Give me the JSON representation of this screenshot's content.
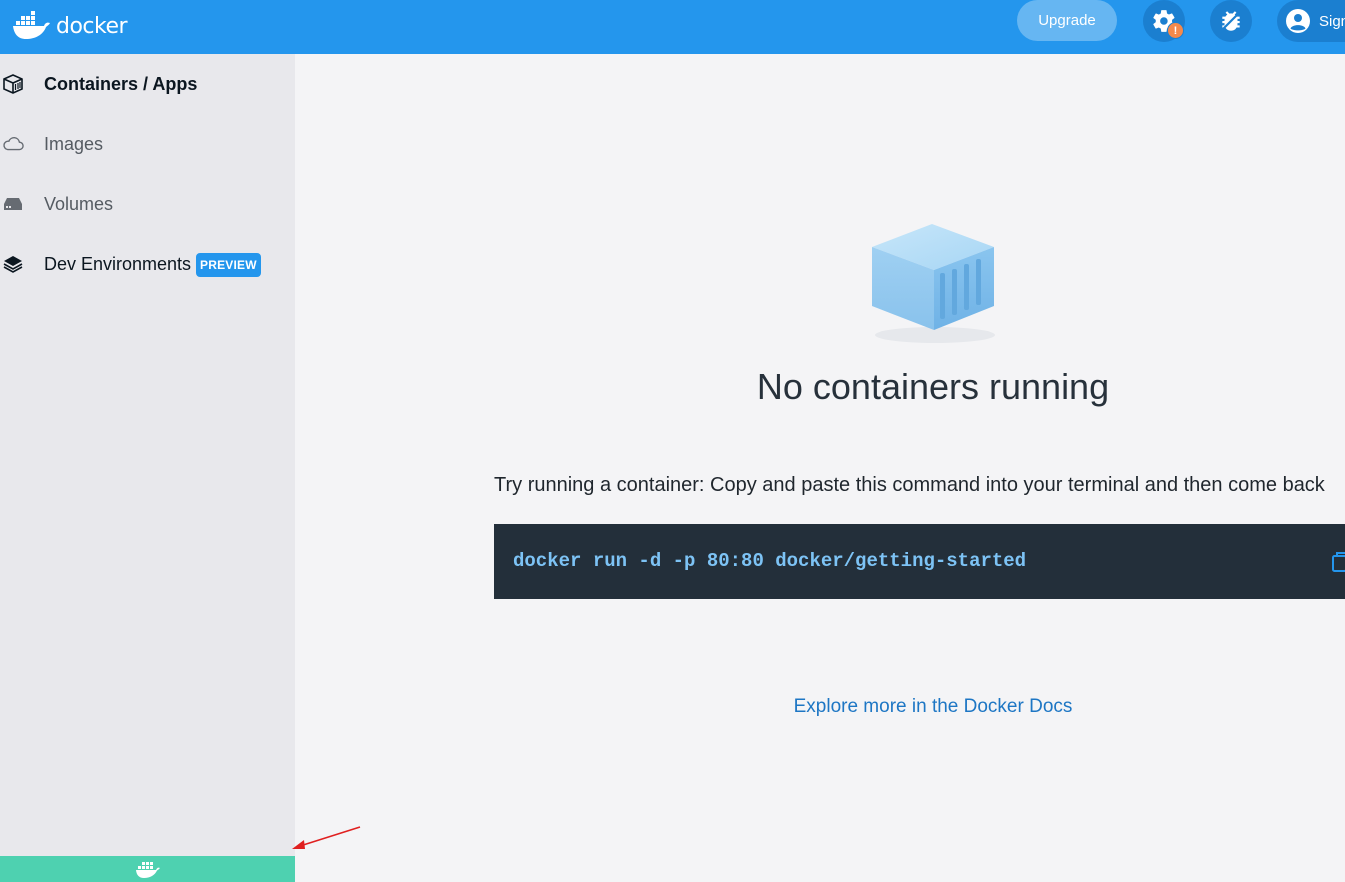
{
  "header": {
    "logo_text": "docker",
    "upgrade_label": "Upgrade",
    "settings_badge": "!",
    "signin_label": "Sign in"
  },
  "sidebar": {
    "items": [
      {
        "label": "Containers / Apps",
        "icon": "container-icon",
        "active": true
      },
      {
        "label": "Images",
        "icon": "cloud-icon",
        "active": false
      },
      {
        "label": "Volumes",
        "icon": "disk-icon",
        "active": false
      },
      {
        "label": "Dev Environments",
        "icon": "layers-icon",
        "active": false,
        "badge": "PREVIEW"
      }
    ]
  },
  "main": {
    "empty_title": "No containers running",
    "try_text": "Try running a container: Copy and paste this command into your terminal and then come back",
    "command": "docker run -d -p 80:80 docker/getting-started",
    "docs_link": "Explore more in the Docker Docs"
  },
  "colors": {
    "header_bg": "#2496ed",
    "status_bar": "#4ed1b0",
    "link": "#1d76c4",
    "command_text": "#7dc3f5"
  }
}
